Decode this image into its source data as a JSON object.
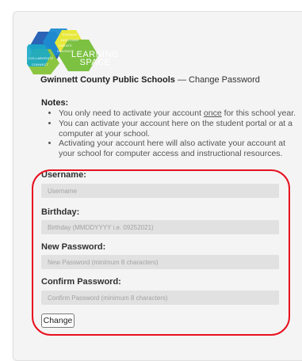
{
  "logo": {
    "main_text": "LEARNING SPACE",
    "small_words": [
      "COLLABORATE",
      "CONNECT",
      "ENGAGE",
      "DISCOVER",
      "CREATE",
      "INNOVATE"
    ]
  },
  "header": {
    "org": "Gwinnett County Public Schools",
    "separator": "—",
    "page": "Change Password"
  },
  "notes": {
    "title": "Notes:",
    "item1_before": "You only need to activate your account ",
    "item1_emph": "once",
    "item1_after": " for this school year.",
    "item2": "You can activate your account here on the student portal or at a computer at your school.",
    "item3": "Activating your account here will also activate your account at your school for computer access and instructional resources."
  },
  "form": {
    "username_label": "Username:",
    "username_placeholder": "Username",
    "birthday_label": "Birthday:",
    "birthday_placeholder": "Birthday (MMDDYYYY i.e. 09252021)",
    "new_password_label": "New Password:",
    "new_password_placeholder": "New Password (minimum 8 characters)",
    "confirm_password_label": "Confirm Password:",
    "confirm_password_placeholder": "Confirm Password (minimum 8 characters)",
    "submit_label": "Change"
  },
  "colors": {
    "highlight": "#e8101e",
    "field_bg": "#e1e1e1"
  }
}
